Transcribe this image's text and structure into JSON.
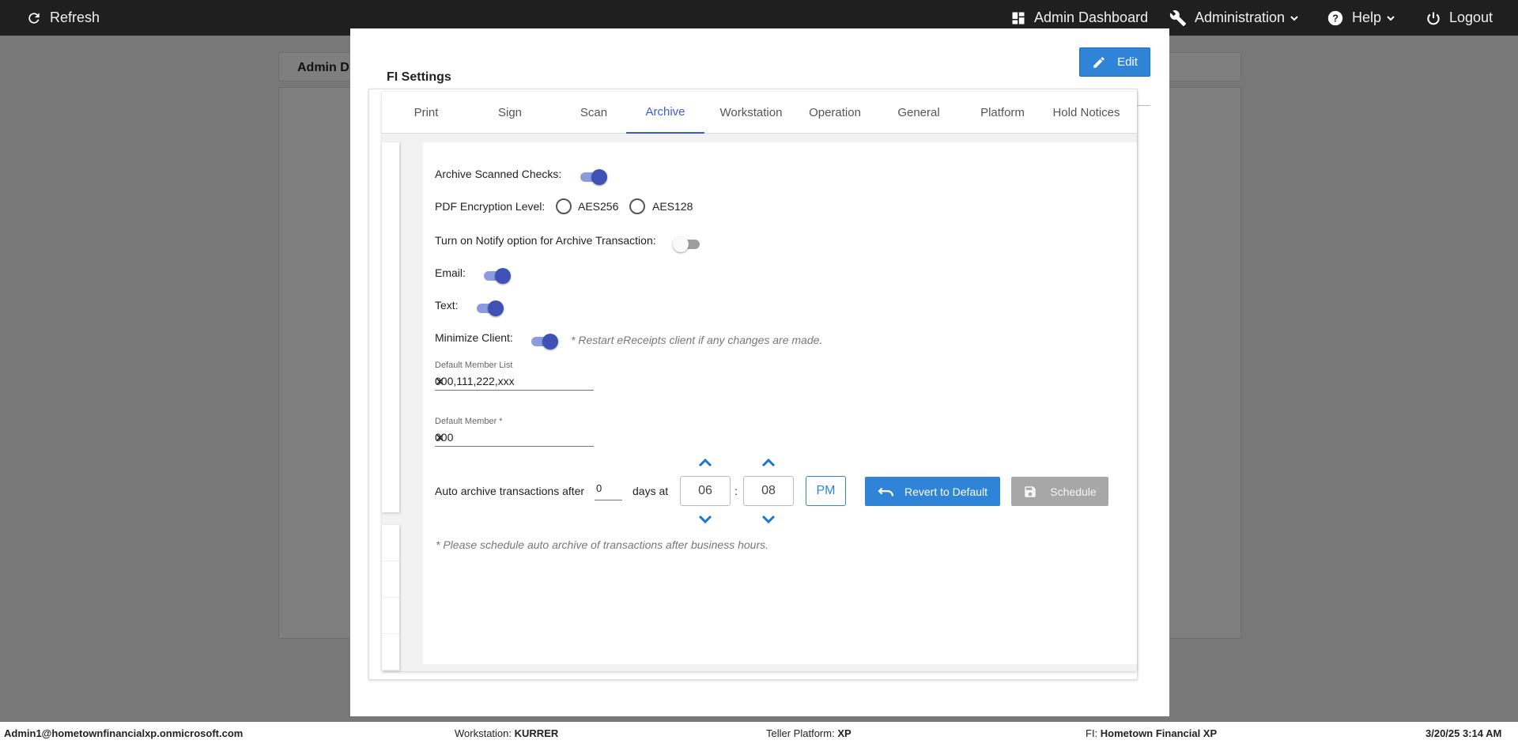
{
  "topbar": {
    "refresh": "Refresh",
    "admin_dashboard": "Admin Dashboard",
    "administration": "Administration",
    "help": "Help",
    "logout": "Logout"
  },
  "background": {
    "tab_title": "Admin D"
  },
  "modal": {
    "title": "FI Settings",
    "edit_label": "Edit",
    "tabs": [
      {
        "label": "Print"
      },
      {
        "label": "Sign"
      },
      {
        "label": "Scan"
      },
      {
        "label": "Archive",
        "active": true
      },
      {
        "label": "Workstation"
      },
      {
        "label": "Operation"
      },
      {
        "label": "General"
      },
      {
        "label": "Platform"
      },
      {
        "label": "Hold Notices"
      }
    ],
    "archive": {
      "archive_scanned_checks_label": "Archive Scanned Checks:",
      "archive_scanned_checks_on": true,
      "pdf_encryption_label": "PDF Encryption Level:",
      "aes256_label": "AES256",
      "aes128_label": "AES128",
      "notify_label": "Turn on Notify option for Archive Transaction:",
      "notify_on": false,
      "email_label": "Email:",
      "email_on": true,
      "text_label": "Text:",
      "text_on": true,
      "minimize_label": "Minimize Client:",
      "minimize_on": true,
      "restart_note": "* Restart eReceipts client if any changes are made.",
      "default_member_list_label": "Default Member List",
      "default_member_list_value": "000,111,222,xxx",
      "default_member_label": "Default Member *",
      "default_member_value": "000",
      "auto_archive_label": "Auto archive transactions after",
      "days_value": "0",
      "days_at_label": "days at",
      "hour": "06",
      "colon": ":",
      "minute": "08",
      "ampm": "PM",
      "revert_label": "Revert to Default",
      "schedule_label": "Schedule",
      "schedule_note": "* Please schedule auto archive of transactions after business hours."
    }
  },
  "statusbar": {
    "user": "Admin1@hometownfinancialxp.onmicrosoft.com",
    "workstation_label": "Workstation:",
    "workstation_value": "KURRER",
    "platform_label": "Teller Platform:",
    "platform_value": "XP",
    "fi_label": "FI:",
    "fi_value": "Hometown Financial XP",
    "datetime": "3/20/25 3:14 AM"
  },
  "colors": {
    "topbar_bg": "#1f1f1f",
    "primary": "#2f84d8",
    "toggle_on": "#3f51b5",
    "tab_active": "#3b5bdb"
  }
}
